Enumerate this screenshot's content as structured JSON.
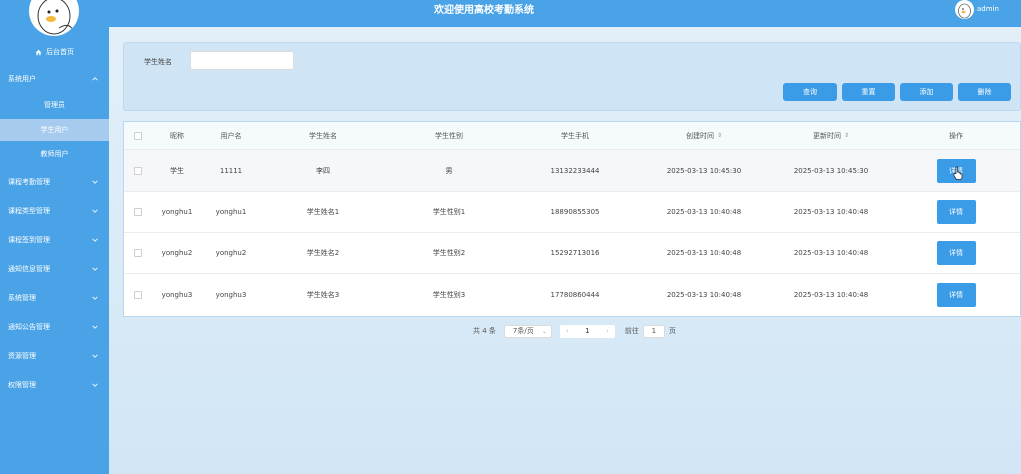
{
  "header": {
    "title": "欢迎使用高校考勤系统",
    "username": "admin"
  },
  "sidebar": {
    "home": "后台首页",
    "system_users": "系统用户",
    "sub_items": [
      "管理员",
      "学生用户",
      "教师用户"
    ],
    "groups": [
      "课程考勤管理",
      "课程类型管理",
      "课程签到管理",
      "通知信息管理",
      "系统管理",
      "通知公告管理",
      "资源管理",
      "权限管理"
    ]
  },
  "search": {
    "label": "学生姓名",
    "value": "",
    "buttons": [
      "查询",
      "重置",
      "添加",
      "删除"
    ]
  },
  "table": {
    "columns": [
      "昵称",
      "用户名",
      "学生姓名",
      "学生性别",
      "学生手机",
      "创建时间",
      "更新时间",
      "操作"
    ],
    "rows": [
      [
        "学生",
        "11111",
        "李四",
        "男",
        "13132233444",
        "2025-03-13 10:45:30",
        "2025-03-13 10:45:30",
        "详情"
      ],
      [
        "yonghu1",
        "yonghu1",
        "学生姓名1",
        "学生性别1",
        "18890855305",
        "2025-03-13 10:40:48",
        "2025-03-13 10:40:48",
        "详情"
      ],
      [
        "yonghu2",
        "yonghu2",
        "学生姓名2",
        "学生性别2",
        "15292713016",
        "2025-03-13 10:40:48",
        "2025-03-13 10:40:48",
        "详情"
      ],
      [
        "yonghu3",
        "yonghu3",
        "学生姓名3",
        "学生性别3",
        "17780860444",
        "2025-03-13 10:40:48",
        "2025-03-13 10:40:48",
        "详情"
      ]
    ]
  },
  "pagination": {
    "total": "共 4 条",
    "page_size": "7条/页",
    "current_page": "1",
    "goto_label": "前往",
    "goto_value": "1",
    "page_suffix": "页"
  },
  "colors": {
    "primary": "#3a9be6",
    "sidebar": "#4aa3e6",
    "active_menu": "#a7cbee"
  }
}
